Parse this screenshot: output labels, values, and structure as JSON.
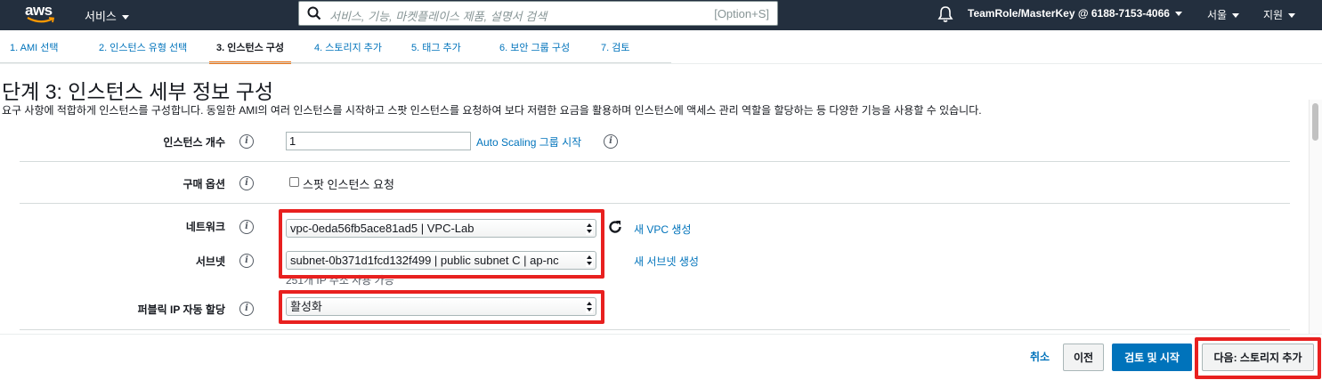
{
  "topnav": {
    "logo_text": "aws",
    "services_label": "서비스",
    "search_placeholder": "서비스, 기능, 마켓플레이스 제품, 설명서 검색",
    "search_shortcut": "[Option+S]",
    "account_label": "TeamRole/MasterKey @ 6188-7153-4066",
    "region_label": "서울",
    "support_label": "지원"
  },
  "steps": [
    {
      "label": "1. AMI 선택",
      "active": false
    },
    {
      "label": "2. 인스턴스 유형 선택",
      "active": false
    },
    {
      "label": "3. 인스턴스 구성",
      "active": true
    },
    {
      "label": "4. 스토리지 추가",
      "active": false
    },
    {
      "label": "5. 태그 추가",
      "active": false
    },
    {
      "label": "6. 보안 그룹 구성",
      "active": false
    },
    {
      "label": "7. 검토",
      "active": false
    }
  ],
  "page": {
    "title": "단계 3: 인스턴스 세부 정보 구성",
    "description": "요구 사항에 적합하게 인스턴스를 구성합니다. 동일한 AMI의 여러 인스턴스를 시작하고 스팟 인스턴스를 요청하여 보다 저렴한 요금을 활용하며 인스턴스에 액세스 관리 역할을 할당하는 등 다양한 기능을 사용할 수 있습니다."
  },
  "form": {
    "instance_count": {
      "label": "인스턴스 개수",
      "value": "1",
      "autoscaling_link": "Auto Scaling 그룹 시작"
    },
    "purchase_option": {
      "label": "구매 옵션",
      "checkbox_label": "스팟 인스턴스 요청",
      "checked": false
    },
    "network": {
      "label": "네트워크",
      "value": "vpc-0eda56fb5ace81ad5 | VPC-Lab",
      "create_link": "새 VPC 생성"
    },
    "subnet": {
      "label": "서브넷",
      "value": "subnet-0b371d1fcd132f499 | public subnet C | ap-nc",
      "create_link": "새 서브넷 생성",
      "ip_available": "251개 IP 주소 사용 가능"
    },
    "public_ip": {
      "label": "퍼블릭 IP 자동 할당",
      "value": "활성화"
    }
  },
  "footer": {
    "cancel_label": "취소",
    "previous_label": "이전",
    "review_launch_label": "검토 및 시작",
    "next_label": "다음: 스토리지 추가"
  },
  "colors": {
    "nav_bg": "#232f3e",
    "link": "#0073bb",
    "active_tab": "#ec7211",
    "highlight": "#e8201f",
    "primary_button": "#0073bb"
  }
}
